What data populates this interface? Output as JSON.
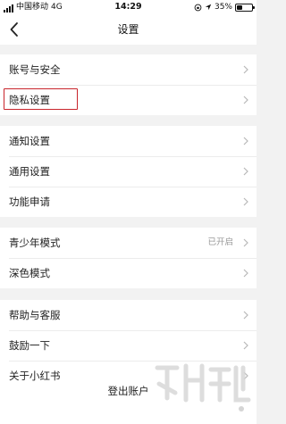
{
  "status_bar": {
    "carrier": "中国移动",
    "network": "4G",
    "time": "14:29",
    "battery": "35%",
    "battery_level": 0.35
  },
  "nav": {
    "title": "设置",
    "back_icon": "chevron-left-icon"
  },
  "groups": [
    {
      "items": [
        {
          "label": "账号与安全"
        },
        {
          "label": "隐私设置",
          "highlighted": true
        }
      ]
    },
    {
      "items": [
        {
          "label": "通知设置"
        },
        {
          "label": "通用设置"
        },
        {
          "label": "功能申请"
        }
      ]
    },
    {
      "items": [
        {
          "label": "青少年模式",
          "value": "已开启"
        },
        {
          "label": "深色模式"
        }
      ]
    },
    {
      "items": [
        {
          "label": "帮助与客服"
        },
        {
          "label": "鼓励一下"
        },
        {
          "label": "关于小红书"
        }
      ]
    }
  ],
  "logout": {
    "label": "登出账户"
  },
  "colors": {
    "highlight": "#c8242b",
    "background": "#f2f2f2",
    "chevron": "#b8b8b8"
  }
}
